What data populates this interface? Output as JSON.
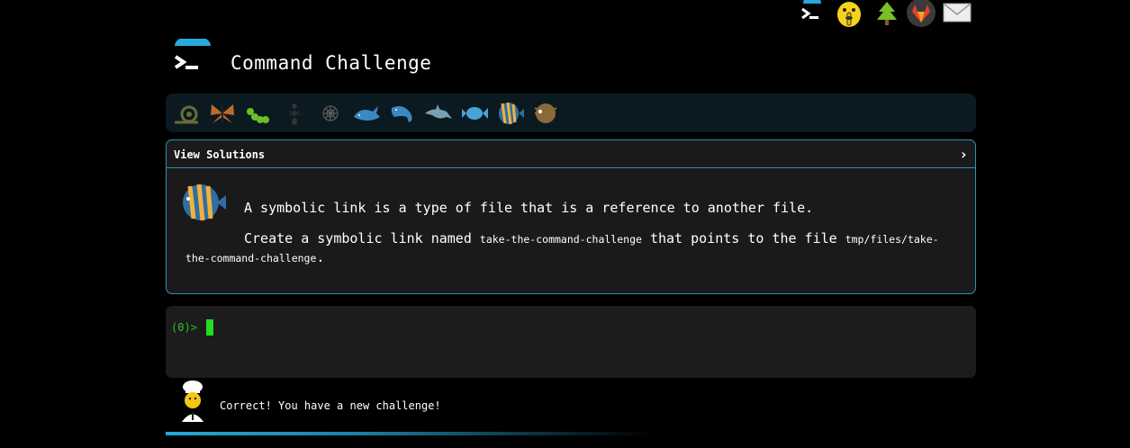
{
  "header": {
    "title": "Command Challenge",
    "top_icons": [
      "terminal-icon",
      "shushing-face-icon",
      "tree-icon",
      "gitlab-icon",
      "mail-icon"
    ]
  },
  "levels": [
    "snail",
    "butterfly",
    "caterpillar",
    "ant",
    "spider-web",
    "whale",
    "whale-2",
    "dolphin",
    "fish",
    "tropical-fish",
    "blowfish"
  ],
  "panel": {
    "header_label": "View Solutions",
    "chevron": "›",
    "line1": "A symbolic link is a type of file that is a reference to another file.",
    "line2_pre": "Create a symbolic link named ",
    "line2_code1": "take-the-command-challenge",
    "line2_mid": " that points to the file ",
    "line2_code2": "tmp/files/take-the-command-challenge",
    "line2_post": "."
  },
  "terminal": {
    "prompt": "(0)>"
  },
  "status": {
    "message": "Correct! You have a new challenge!"
  }
}
